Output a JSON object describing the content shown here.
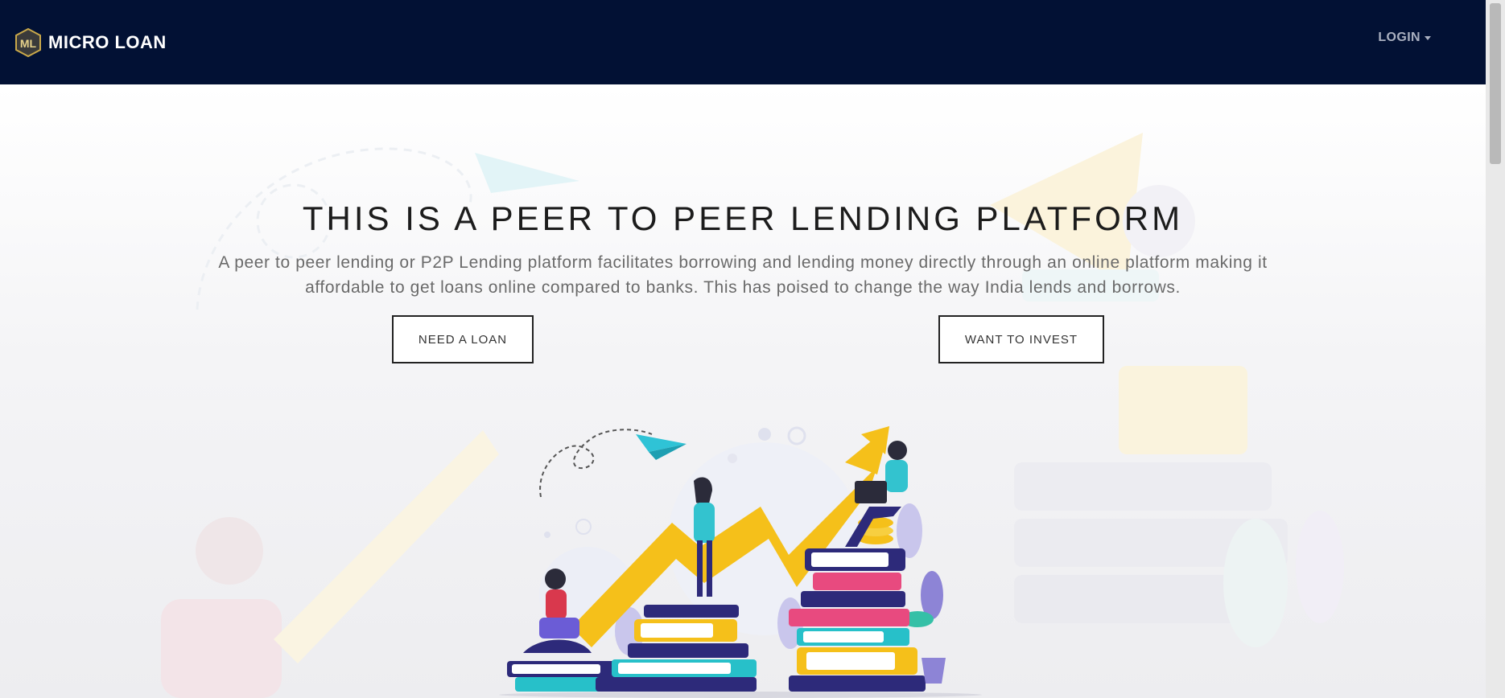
{
  "navbar": {
    "brand_logo_text": "ML",
    "brand_name": "MICRO LOAN",
    "login_label": "LOGIN",
    "background_color": "#021134",
    "login_icon": "caret-down-icon"
  },
  "hero": {
    "title": "THIS IS A PEER TO PEER LENDING PLATFORM",
    "description": "A peer to peer lending or P2P Lending platform facilitates borrowing and lending money directly through an online platform making it affordable to get loans online compared to banks. This has poised to change the way India lends and borrows.",
    "buttons": {
      "need_loan": "NEED A LOAN",
      "want_invest": "WANT TO INVEST"
    }
  },
  "illustration": {
    "name": "peer-lending-growth-illustration",
    "colors": {
      "arrow": "#f5c01a",
      "book_dark": "#2d2a7a",
      "book_teal": "#27c0c9",
      "book_pink": "#e84a7f",
      "plane": "#2fc3d6"
    }
  }
}
